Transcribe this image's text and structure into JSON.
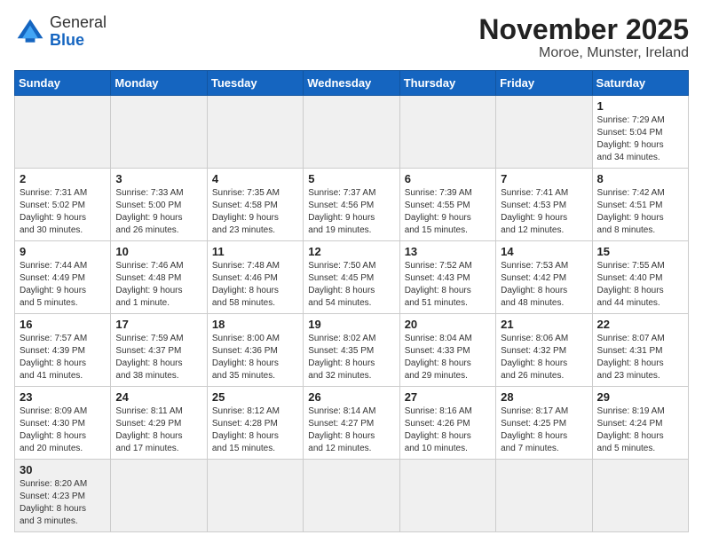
{
  "header": {
    "logo_general": "General",
    "logo_blue": "Blue",
    "title": "November 2025",
    "subtitle": "Moroe, Munster, Ireland"
  },
  "weekdays": [
    "Sunday",
    "Monday",
    "Tuesday",
    "Wednesday",
    "Thursday",
    "Friday",
    "Saturday"
  ],
  "weeks": [
    [
      {
        "day": "",
        "info": ""
      },
      {
        "day": "",
        "info": ""
      },
      {
        "day": "",
        "info": ""
      },
      {
        "day": "",
        "info": ""
      },
      {
        "day": "",
        "info": ""
      },
      {
        "day": "",
        "info": ""
      },
      {
        "day": "1",
        "info": "Sunrise: 7:29 AM\nSunset: 5:04 PM\nDaylight: 9 hours\nand 34 minutes."
      }
    ],
    [
      {
        "day": "2",
        "info": "Sunrise: 7:31 AM\nSunset: 5:02 PM\nDaylight: 9 hours\nand 30 minutes."
      },
      {
        "day": "3",
        "info": "Sunrise: 7:33 AM\nSunset: 5:00 PM\nDaylight: 9 hours\nand 26 minutes."
      },
      {
        "day": "4",
        "info": "Sunrise: 7:35 AM\nSunset: 4:58 PM\nDaylight: 9 hours\nand 23 minutes."
      },
      {
        "day": "5",
        "info": "Sunrise: 7:37 AM\nSunset: 4:56 PM\nDaylight: 9 hours\nand 19 minutes."
      },
      {
        "day": "6",
        "info": "Sunrise: 7:39 AM\nSunset: 4:55 PM\nDaylight: 9 hours\nand 15 minutes."
      },
      {
        "day": "7",
        "info": "Sunrise: 7:41 AM\nSunset: 4:53 PM\nDaylight: 9 hours\nand 12 minutes."
      },
      {
        "day": "8",
        "info": "Sunrise: 7:42 AM\nSunset: 4:51 PM\nDaylight: 9 hours\nand 8 minutes."
      }
    ],
    [
      {
        "day": "9",
        "info": "Sunrise: 7:44 AM\nSunset: 4:49 PM\nDaylight: 9 hours\nand 5 minutes."
      },
      {
        "day": "10",
        "info": "Sunrise: 7:46 AM\nSunset: 4:48 PM\nDaylight: 9 hours\nand 1 minute."
      },
      {
        "day": "11",
        "info": "Sunrise: 7:48 AM\nSunset: 4:46 PM\nDaylight: 8 hours\nand 58 minutes."
      },
      {
        "day": "12",
        "info": "Sunrise: 7:50 AM\nSunset: 4:45 PM\nDaylight: 8 hours\nand 54 minutes."
      },
      {
        "day": "13",
        "info": "Sunrise: 7:52 AM\nSunset: 4:43 PM\nDaylight: 8 hours\nand 51 minutes."
      },
      {
        "day": "14",
        "info": "Sunrise: 7:53 AM\nSunset: 4:42 PM\nDaylight: 8 hours\nand 48 minutes."
      },
      {
        "day": "15",
        "info": "Sunrise: 7:55 AM\nSunset: 4:40 PM\nDaylight: 8 hours\nand 44 minutes."
      }
    ],
    [
      {
        "day": "16",
        "info": "Sunrise: 7:57 AM\nSunset: 4:39 PM\nDaylight: 8 hours\nand 41 minutes."
      },
      {
        "day": "17",
        "info": "Sunrise: 7:59 AM\nSunset: 4:37 PM\nDaylight: 8 hours\nand 38 minutes."
      },
      {
        "day": "18",
        "info": "Sunrise: 8:00 AM\nSunset: 4:36 PM\nDaylight: 8 hours\nand 35 minutes."
      },
      {
        "day": "19",
        "info": "Sunrise: 8:02 AM\nSunset: 4:35 PM\nDaylight: 8 hours\nand 32 minutes."
      },
      {
        "day": "20",
        "info": "Sunrise: 8:04 AM\nSunset: 4:33 PM\nDaylight: 8 hours\nand 29 minutes."
      },
      {
        "day": "21",
        "info": "Sunrise: 8:06 AM\nSunset: 4:32 PM\nDaylight: 8 hours\nand 26 minutes."
      },
      {
        "day": "22",
        "info": "Sunrise: 8:07 AM\nSunset: 4:31 PM\nDaylight: 8 hours\nand 23 minutes."
      }
    ],
    [
      {
        "day": "23",
        "info": "Sunrise: 8:09 AM\nSunset: 4:30 PM\nDaylight: 8 hours\nand 20 minutes."
      },
      {
        "day": "24",
        "info": "Sunrise: 8:11 AM\nSunset: 4:29 PM\nDaylight: 8 hours\nand 17 minutes."
      },
      {
        "day": "25",
        "info": "Sunrise: 8:12 AM\nSunset: 4:28 PM\nDaylight: 8 hours\nand 15 minutes."
      },
      {
        "day": "26",
        "info": "Sunrise: 8:14 AM\nSunset: 4:27 PM\nDaylight: 8 hours\nand 12 minutes."
      },
      {
        "day": "27",
        "info": "Sunrise: 8:16 AM\nSunset: 4:26 PM\nDaylight: 8 hours\nand 10 minutes."
      },
      {
        "day": "28",
        "info": "Sunrise: 8:17 AM\nSunset: 4:25 PM\nDaylight: 8 hours\nand 7 minutes."
      },
      {
        "day": "29",
        "info": "Sunrise: 8:19 AM\nSunset: 4:24 PM\nDaylight: 8 hours\nand 5 minutes."
      }
    ],
    [
      {
        "day": "30",
        "info": "Sunrise: 8:20 AM\nSunset: 4:23 PM\nDaylight: 8 hours\nand 3 minutes.",
        "last": true
      },
      {
        "day": "",
        "info": "",
        "last": true
      },
      {
        "day": "",
        "info": "",
        "last": true
      },
      {
        "day": "",
        "info": "",
        "last": true
      },
      {
        "day": "",
        "info": "",
        "last": true
      },
      {
        "day": "",
        "info": "",
        "last": true
      },
      {
        "day": "",
        "info": "",
        "last": true
      }
    ]
  ]
}
